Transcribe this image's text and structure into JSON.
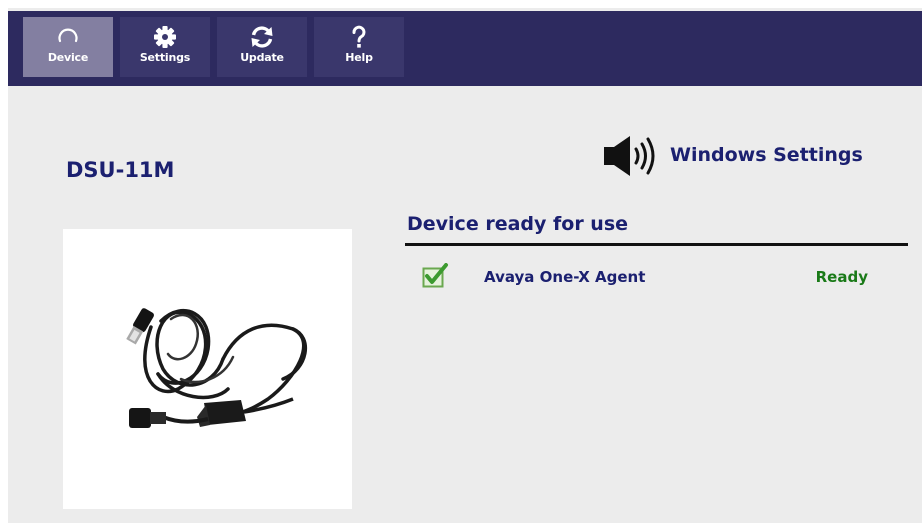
{
  "nav": {
    "items": [
      {
        "label": "Device",
        "icon": "circle-arc-icon",
        "active": true
      },
      {
        "label": "Settings",
        "icon": "gear-icon",
        "active": false
      },
      {
        "label": "Update",
        "icon": "refresh-icon",
        "active": false
      },
      {
        "label": "Help",
        "icon": "question-icon",
        "active": false
      }
    ]
  },
  "device": {
    "name": "DSU-11M"
  },
  "windows_settings": {
    "label": "Windows Settings",
    "icon": "speaker-icon"
  },
  "status_section": {
    "heading": "Device ready for use",
    "apps": [
      {
        "name": "Avaya One-X Agent",
        "status": "Ready",
        "checked": true
      }
    ]
  },
  "colors": {
    "topbar": "#2d2a5f",
    "nav_active": "#837fa1",
    "nav_inactive": "#3a376c",
    "title_text": "#1b2070",
    "ready_text": "#1a7a18",
    "background": "#ececec"
  }
}
